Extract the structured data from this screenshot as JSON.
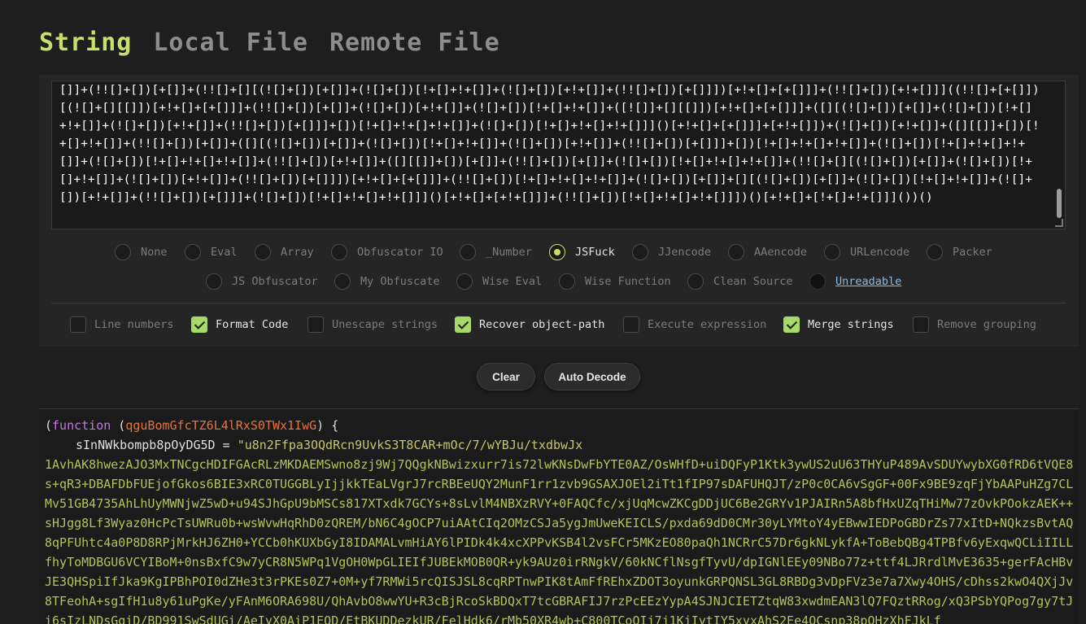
{
  "tabs": [
    {
      "label": "String",
      "active": true
    },
    {
      "label": "Local File",
      "active": false
    },
    {
      "label": "Remote File",
      "active": false
    }
  ],
  "input": {
    "value": "[]]+(!![]+[])[+[]]+(!![]+[][(![]+[])[+[]]+(![]+[])[!+[]+!+[]]+(![]+[])[+!+[]]+(!![]+[])[+[]]])[+!+[]+[+[]]]+(!![]+[])[+!+[]]]((!![]+[+[]])[(![]+[][[]])[+!+[]+[+[]]]+(!![]+[])[+[]]+(![]+[])[+!+[]]+(![]+[])[!+[]+!+[]]+([![]]+[][[]])[+!+[]+[+[]]]+([][(![]+[])[+[]]+(![]+[])[!+[]+!+[]]+(![]+[])[+!+[]]+(!![]+[])[+[]]]+[])[!+[]+!+[]+!+[]]+(![]+[])[!+[]+!+[]+!+[]]]()[+!+[]+[+[]]]+[+!+[]])+(![]+[])[+!+[]]+([][[]]+[])[!+[]+!+[]]+(!![]+[])[+[]]+([][(![]+[])[+[]]+(![]+[])[!+[]+!+[]]+(![]+[])[+!+[]]+(!![]+[])[+[]]]+[])[!+[]+!+[]+!+[]]+(![]+[])[!+[]+!+[]+!+[]]+(![]+[])[!+[]+!+[]+!+[]]+(!![]+[])[+!+[]]+([][[]]+[])[+[]]+(!![]+[])[+[]]+(![]+[])[!+[]+!+[]+!+[]]+(!![]+[][(![]+[])[+[]]+(![]+[])[!+[]+!+[]]+(![]+[])[+!+[]]+(!![]+[])[+[]]])[+!+[]+[+[]]]+(!![]+[])[!+[]+!+[]+!+[]]+(![]+[])[+[]]+[][(![]+[])[+[]]+(![]+[])[!+[]+!+[]]+(![]+[])[+!+[]]+(!![]+[])[+[]]]+(![]+[])[!+[]+!+[]+!+[]]]()[+!+[]+[+!+[]]]+(!![]+[])[!+[]+!+[]+!+[]]])()[+!+[]+[!+[]+!+[]]]())()"
  },
  "modes_row1": [
    {
      "label": "None",
      "checked": false
    },
    {
      "label": "Eval",
      "checked": false
    },
    {
      "label": "Array",
      "checked": false
    },
    {
      "label": "Obfuscator IO",
      "checked": false
    },
    {
      "label": "_Number",
      "checked": false
    },
    {
      "label": "JSFuck",
      "checked": true
    },
    {
      "label": "JJencode",
      "checked": false
    },
    {
      "label": "AAencode",
      "checked": false
    },
    {
      "label": "URLencode",
      "checked": false
    },
    {
      "label": "Packer",
      "checked": false
    }
  ],
  "modes_row2": [
    {
      "label": "JS Obfuscator",
      "checked": false
    },
    {
      "label": "My Obfuscate",
      "checked": false
    },
    {
      "label": "Wise Eval",
      "checked": false
    },
    {
      "label": "Wise Function",
      "checked": false
    },
    {
      "label": "Clean Source",
      "checked": false
    },
    {
      "label": "Unreadable",
      "checked": false
    }
  ],
  "options": [
    {
      "label": "Line numbers",
      "checked": false
    },
    {
      "label": "Format Code",
      "checked": true
    },
    {
      "label": "Unescape strings",
      "checked": false
    },
    {
      "label": "Recover object-path",
      "checked": true
    },
    {
      "label": "Execute expression",
      "checked": false
    },
    {
      "label": "Merge strings",
      "checked": true
    },
    {
      "label": "Remove grouping",
      "checked": false
    }
  ],
  "buttons": {
    "clear": "Clear",
    "auto_decode": "Auto Decode"
  },
  "output": {
    "paren_open": "(",
    "keyword": "function",
    "space_paren": " (",
    "param": "qguBomGfcTZ6L4lRxS0TWx1IwG",
    "close": ") {",
    "var_name": "sInNWkbompb8pOyDG5D",
    "assign": " = ",
    "string_value": "\"u8n2Ffpa3OQdRcn9UvkS3T8CAR+mOc/7/wYBJu/txdbwJx1AvhAK8hwezAJO3MxTNCgcHDIFGAcRLzMKDAEMSwno8zj9Wj7QQgkNBwizxurr7is72lwKNsDwFbYTE0AZ/OsWHfD+uiDQFyP1Ktk3ywUS2uU63THYuP489AvSDUYwybXG0fRD6tVQE8s+qR3+DBAFDbFUEjofGkos6BIE3xRC0TUGGBLyIjjkkTEaLVgrJ7rcRBEeUQY2MunF1rr1zvb9GSAXJOEl2iTt1fIP97sDAFUHQJT/zP0c0CA6vSgGF+00Fx9BE9zqFjYbAAPuHZg7CLMv51GB4735AhLhUyMWNjwZ5wD+u94SJhGpU9bMSCs817XTxdk7GCYs+8sLvlM4NBXzRVY+0FAQCfc/xjUqMcwZKCgDDjUC6Be2GRYv1PJAIRn5A8bfHxUZqTHiMw77zOvkPOokzAEK++sHJgg8Lf3Wyaz0HcPcTsUWRu0b+wsWvwHqRhD0zQREM/bN6C4gOCP7uiAAtCIq2OMzCSJa5ygJmUweKEICLS/pxda69dD0CMr30yLYMtoY4yEBwwIEDPoGBDrZs77xItD+NQkzsBvtAQ8qPFUhtc4a0P8D8RPjMrkHJ6ZH0+YCCb0hKUXbGyI8IDAMALvmHiAY6lPIDk4k4xcXPPvKSB4l2vsFCr5MKzEO80paQh1NCRrC57Dr6gkNLykfA+ToBebQBg4TPBfv6yExqwQCLiIILLfhyToMDBGU6VCYIBoM+0nsBxfC9w7yCR8N5WPq1VgOH0WpGLIEIfJUBEkMOB0QR+yk9AUz0irRNgkV/60kNCflNsgfTyvU/dpIGNlEEy09NBo77z+ttf4LJRrdlMvE3635+gerFAcHBvJE3QHSpiIfJka9KgIPBhPOI0dZHe3t3rPKEs0Z7+0M+yf7RMWi5rcQISJSL8cqRPTnwPIK8tAmFfREhxZDOT3oyunkGRPQNSL3GL8RBDg3vDpFVz3e7a7Xwy4OHS/cDhss2kwO4QXjJv8TFeohA+sgIfH1u8y61uPgKe/yFAnM6ORA698U/QhAvbO8wwYU+R3cBjRcoSkBDQxT7tcGBRAFIJ7rzPcEEzYypA4SJNJCIETZtqW83xwdmEAN3lQ7FQztRRog/xQ3PSbYQPog7gy7tJi6sIzLNDsGqiD/BD991SwSdUGi/AeIyX0AiP1EQD/EtBKUDDezkUR/FelHdk6/rMb50XR4wb+C800TCoOIj7j1KjIytIY5xyxAhS2Ee4OCsnp38pOHzXhFJkLf"
  }
}
